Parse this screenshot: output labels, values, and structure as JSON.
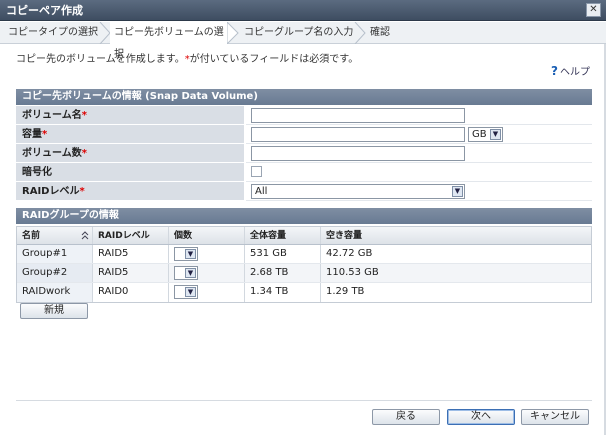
{
  "window": {
    "title": "コピーペア作成",
    "close_symbol": "✕"
  },
  "steps": [
    {
      "label": "コピータイプの選択"
    },
    {
      "label": "コピー先ボリュームの選択"
    },
    {
      "label": "コピーグループ名の入力"
    },
    {
      "label": "確認"
    }
  ],
  "description": {
    "text1": "コピー先のボリュームを作成します。",
    "required_mark": "*",
    "text2": "が付いているフィールドは必須です。"
  },
  "help": {
    "icon": "?",
    "label": "ヘルプ"
  },
  "volume_section": {
    "title": "コピー先ボリュームの情報 (Snap Data Volume)",
    "fields": {
      "name": {
        "label": "ボリューム名",
        "required": "*",
        "value": ""
      },
      "capacity": {
        "label": "容量",
        "required": "*",
        "value": "",
        "unit": "GB"
      },
      "count": {
        "label": "ボリューム数",
        "required": "*",
        "value": ""
      },
      "encryption": {
        "label": "暗号化"
      },
      "raid_level": {
        "label": "RAIDレベル",
        "required": "*",
        "value": "All"
      }
    }
  },
  "raid_section": {
    "title": "RAIDグループの情報",
    "columns": [
      "名前",
      "RAIDレベル",
      "個数",
      "全体容量",
      "空き容量"
    ],
    "rows": [
      {
        "name": "Group#1",
        "raid": "RAID5",
        "total": "531 GB",
        "free": "42.72 GB"
      },
      {
        "name": "Group#2",
        "raid": "RAID5",
        "total": "2.68 TB",
        "free": "110.53 GB"
      },
      {
        "name": "RAIDwork",
        "raid": "RAID0",
        "total": "1.34 TB",
        "free": "1.29 TB"
      }
    ],
    "new_button": "新規"
  },
  "footer": {
    "back": "戻る",
    "next": "次へ",
    "cancel": "キャンセル"
  }
}
